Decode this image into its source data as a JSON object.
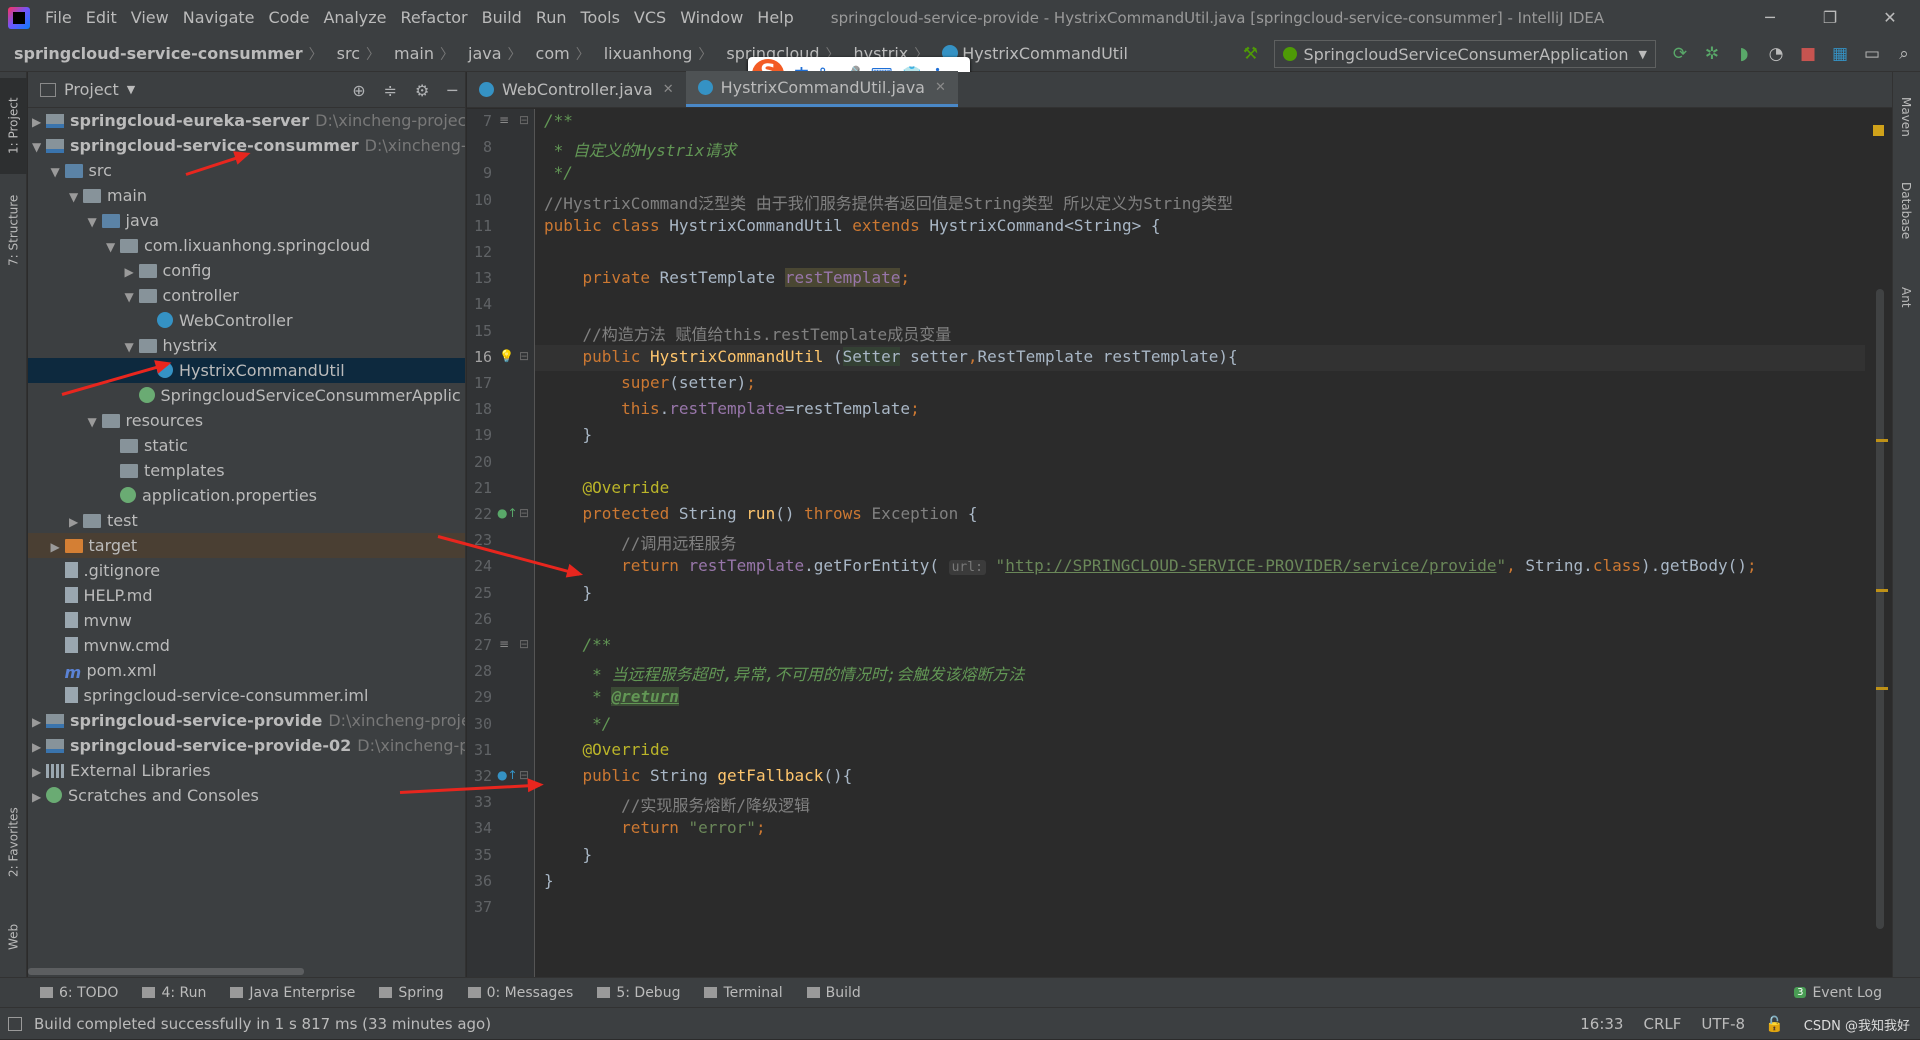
{
  "menu": [
    "File",
    "Edit",
    "View",
    "Navigate",
    "Code",
    "Analyze",
    "Refactor",
    "Build",
    "Run",
    "Tools",
    "VCS",
    "Window",
    "Help"
  ],
  "window_title": "springcloud-service-provide - HystrixCommandUtil.java [springcloud-service-consummer] - IntelliJ IDEA",
  "breadcrumbs": [
    "springcloud-service-consummer",
    "src",
    "main",
    "java",
    "com",
    "lixuanhong",
    "springcloud",
    "hystrix",
    "HystrixCommandUtil"
  ],
  "run_config": "SpringcloudServiceConsumerApplication",
  "ime": {
    "logo": "S",
    "items": [
      "中",
      "°,",
      "🎤",
      "⌨",
      "👕",
      "✣"
    ]
  },
  "left_tabs": [
    "1: Project",
    "7: Structure",
    "2: Favorites",
    "Web"
  ],
  "right_tabs": [
    "Maven",
    "Database",
    "Ant"
  ],
  "project_panel": {
    "title": "Project"
  },
  "tree": [
    {
      "indent": 0,
      "arrow": "▶",
      "icon": "module",
      "label": "springcloud-eureka-server",
      "bold": true,
      "path": "D:\\xincheng-project\\spri"
    },
    {
      "indent": 0,
      "arrow": "▼",
      "icon": "module",
      "label": "springcloud-service-consummer",
      "bold": true,
      "path": "D:\\xincheng-projec"
    },
    {
      "indent": 1,
      "arrow": "▼",
      "icon": "src",
      "label": "src"
    },
    {
      "indent": 2,
      "arrow": "▼",
      "icon": "folder",
      "label": "main"
    },
    {
      "indent": 3,
      "arrow": "▼",
      "icon": "src",
      "label": "java"
    },
    {
      "indent": 4,
      "arrow": "▼",
      "icon": "folder",
      "label": "com.lixuanhong.springcloud"
    },
    {
      "indent": 5,
      "arrow": "▶",
      "icon": "folder",
      "label": "config"
    },
    {
      "indent": 5,
      "arrow": "▼",
      "icon": "folder",
      "label": "controller"
    },
    {
      "indent": 6,
      "arrow": "",
      "icon": "cls",
      "label": "WebController"
    },
    {
      "indent": 5,
      "arrow": "▼",
      "icon": "folder",
      "label": "hystrix"
    },
    {
      "indent": 6,
      "arrow": "",
      "icon": "cls",
      "label": "HystrixCommandUtil",
      "selected": true
    },
    {
      "indent": 5,
      "arrow": "",
      "icon": "spring",
      "label": "SpringcloudServiceConsummerApplic"
    },
    {
      "indent": 3,
      "arrow": "▼",
      "icon": "folder",
      "label": "resources"
    },
    {
      "indent": 4,
      "arrow": "",
      "icon": "folder",
      "label": "static"
    },
    {
      "indent": 4,
      "arrow": "",
      "icon": "folder",
      "label": "templates"
    },
    {
      "indent": 4,
      "arrow": "",
      "icon": "spring",
      "label": "application.properties"
    },
    {
      "indent": 2,
      "arrow": "▶",
      "icon": "folder",
      "label": "test"
    },
    {
      "indent": 1,
      "arrow": "▶",
      "icon": "orange",
      "label": "target",
      "target": true
    },
    {
      "indent": 1,
      "arrow": "",
      "icon": "file",
      "label": ".gitignore"
    },
    {
      "indent": 1,
      "arrow": "",
      "icon": "file",
      "label": "HELP.md"
    },
    {
      "indent": 1,
      "arrow": "",
      "icon": "file",
      "label": "mvnw"
    },
    {
      "indent": 1,
      "arrow": "",
      "icon": "file",
      "label": "mvnw.cmd"
    },
    {
      "indent": 1,
      "arrow": "",
      "icon": "m",
      "label": "pom.xml"
    },
    {
      "indent": 1,
      "arrow": "",
      "icon": "file",
      "label": "springcloud-service-consummer.iml"
    },
    {
      "indent": 0,
      "arrow": "▶",
      "icon": "module",
      "label": "springcloud-service-provide",
      "bold": true,
      "path": "D:\\xincheng-project\\sp"
    },
    {
      "indent": 0,
      "arrow": "▶",
      "icon": "module",
      "label": "springcloud-service-provide-02",
      "bold": true,
      "path": "D:\\xincheng-project"
    },
    {
      "indent": 0,
      "arrow": "▶",
      "icon": "lib",
      "label": "External Libraries"
    },
    {
      "indent": 0,
      "arrow": "▶",
      "icon": "spring",
      "label": "Scratches and Consoles"
    }
  ],
  "editor_tabs": [
    {
      "label": "WebController.java",
      "active": false
    },
    {
      "label": "HystrixCommandUtil.java",
      "active": true
    }
  ],
  "code": {
    "first_line": 7,
    "current_line": 16,
    "lines": [
      [
        [
          "doc",
          "/**"
        ]
      ],
      [
        [
          "doc",
          " * 自定义的Hystrix请求"
        ]
      ],
      [
        [
          "doc",
          " */"
        ]
      ],
      [
        [
          "c",
          "//HystrixCommand泛型类 由于我们服务提供者返回值是String类型 所以定义为String类型"
        ]
      ],
      [
        [
          "k",
          "public class "
        ],
        [
          "",
          "HystrixCommandUtil "
        ],
        [
          "k",
          "extends "
        ],
        [
          "",
          "HystrixCommand<String> {"
        ]
      ],
      [],
      [
        [
          "",
          "    "
        ],
        [
          "k",
          "private "
        ],
        [
          "",
          "RestTemplate "
        ],
        [
          "fld-hl",
          "restTemplate"
        ],
        [
          "k",
          ";"
        ]
      ],
      [],
      [
        [
          "",
          "    "
        ],
        [
          "c",
          "//构造方法 赋值给this.restTemplate成员变量"
        ]
      ],
      [
        [
          "",
          "    "
        ],
        [
          "k",
          "public "
        ],
        [
          "fn",
          "HystrixCommandUtil "
        ],
        [
          "",
          "("
        ],
        [
          "typ-hl",
          "Setter"
        ],
        [
          "",
          " setter"
        ],
        [
          "k",
          ","
        ],
        [
          "",
          "RestTemplate restTemplate){"
        ]
      ],
      [
        [
          "",
          "        "
        ],
        [
          "k",
          "super"
        ],
        [
          "",
          "(setter)"
        ],
        [
          "k",
          ";"
        ]
      ],
      [
        [
          "",
          "        "
        ],
        [
          "k",
          "this"
        ],
        [
          "",
          "."
        ],
        [
          "fld",
          "restTemplate"
        ],
        [
          "",
          "=restTemplate"
        ],
        [
          "k",
          ";"
        ]
      ],
      [
        [
          "",
          "    }"
        ]
      ],
      [],
      [
        [
          "",
          "    "
        ],
        [
          "ann",
          "@Override"
        ]
      ],
      [
        [
          "",
          "    "
        ],
        [
          "k",
          "protected "
        ],
        [
          "",
          "String "
        ],
        [
          "fn",
          "run"
        ],
        [
          "",
          "() "
        ],
        [
          "k",
          "throws "
        ],
        [
          "gray",
          "Exception"
        ],
        [
          "",
          " {"
        ]
      ],
      [
        [
          "",
          "        "
        ],
        [
          "c",
          "//调用远程服务"
        ]
      ],
      [
        [
          "",
          "        "
        ],
        [
          "k",
          "return "
        ],
        [
          "fld",
          "restTemplate"
        ],
        [
          "",
          ".getForEntity( "
        ],
        [
          "param-hint",
          "url:"
        ],
        [
          "",
          " "
        ],
        [
          "str",
          "\""
        ],
        [
          "url",
          "http://SPRINGCLOUD-SERVICE-PROVIDER/service/provide"
        ],
        [
          "str",
          "\""
        ],
        [
          "k",
          ", "
        ],
        [
          "",
          "String."
        ],
        [
          "k",
          "class"
        ],
        [
          "",
          ").getBody()"
        ],
        [
          "k",
          ";"
        ]
      ],
      [
        [
          "",
          "    }"
        ]
      ],
      [],
      [
        [
          "",
          "    "
        ],
        [
          "doc",
          "/**"
        ]
      ],
      [
        [
          "",
          "    "
        ],
        [
          "doc",
          " * 当远程服务超时,异常,不可用的情况时;会触发该熔断方法"
        ]
      ],
      [
        [
          "",
          "    "
        ],
        [
          "doc",
          " * "
        ],
        [
          "doctag",
          "@return"
        ]
      ],
      [
        [
          "",
          "    "
        ],
        [
          "doc",
          " */"
        ]
      ],
      [
        [
          "",
          "    "
        ],
        [
          "ann",
          "@Override"
        ]
      ],
      [
        [
          "",
          "    "
        ],
        [
          "k",
          "public "
        ],
        [
          "",
          "String "
        ],
        [
          "fn",
          "getFallback"
        ],
        [
          "",
          "(){"
        ]
      ],
      [
        [
          "",
          "        "
        ],
        [
          "c",
          "//实现服务熔断/降级逻辑"
        ]
      ],
      [
        [
          "",
          "        "
        ],
        [
          "k",
          "return "
        ],
        [
          "str",
          "\"error\""
        ],
        [
          "k",
          ";"
        ]
      ],
      [
        [
          "",
          "    }"
        ]
      ],
      [
        [
          "",
          "}"
        ]
      ],
      []
    ]
  },
  "bottom_tools": [
    "6: TODO",
    "4: Run",
    "Java Enterprise",
    "Spring",
    "0: Messages",
    "5: Debug",
    "Terminal",
    "Build"
  ],
  "event_log": {
    "count": "3",
    "label": "Event Log"
  },
  "status": {
    "message": "Build completed successfully in 1 s 817 ms (33 minutes ago)",
    "position": "16:33",
    "line_sep": "CRLF",
    "encoding": "UTF-8",
    "watermark": "CSDN @我知我好"
  }
}
